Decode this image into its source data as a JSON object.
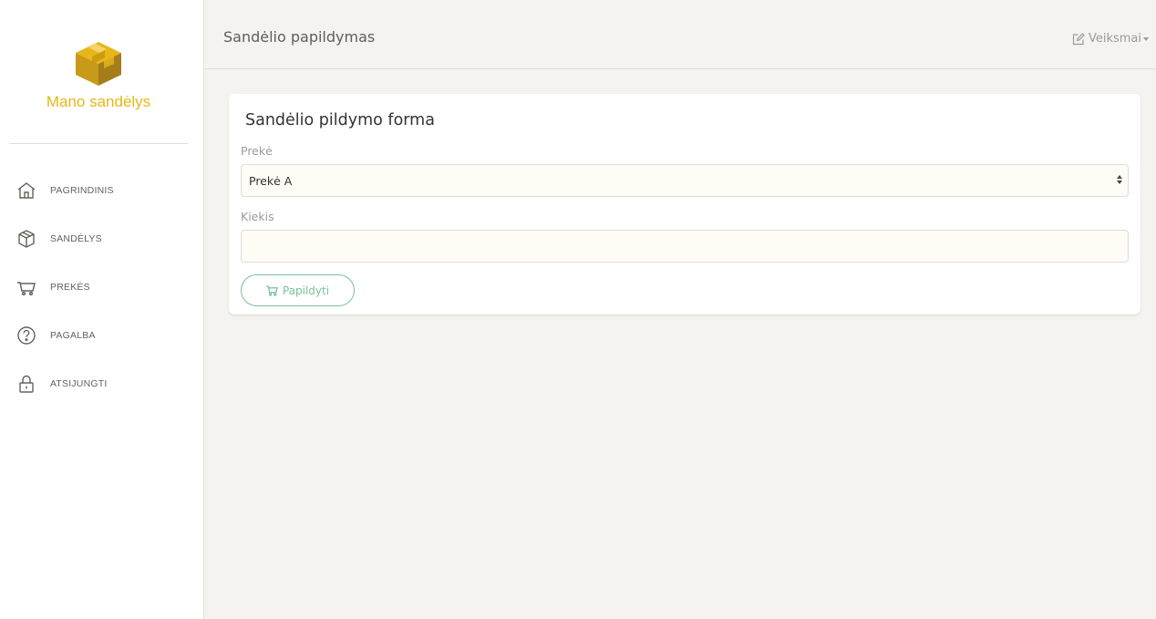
{
  "brand": {
    "name": "Mano sandėlys",
    "color": "#e8b618",
    "logo_icon": "box-icon"
  },
  "sidebar": {
    "items": [
      {
        "label": "PAGRINDINIS",
        "icon": "home-icon"
      },
      {
        "label": "SANDĖLYS",
        "icon": "box-icon"
      },
      {
        "label": "PREKĖS",
        "icon": "cart-icon"
      },
      {
        "label": "PAGALBA",
        "icon": "help-icon"
      },
      {
        "label": "ATSIJUNGTI",
        "icon": "lock-icon"
      }
    ]
  },
  "header": {
    "title": "Sandėlio papildymas",
    "actions_label": "Veiksmai",
    "actions_icon": "edit-icon"
  },
  "form": {
    "title": "Sandėlio pildymo forma",
    "product_label": "Prekė",
    "product_value": "Prekė A",
    "quantity_label": "Kiekis",
    "quantity_value": "",
    "quantity_placeholder": "",
    "submit_label": "Papildyti",
    "submit_icon": "cart-icon",
    "accent_color": "#7ac29a"
  }
}
